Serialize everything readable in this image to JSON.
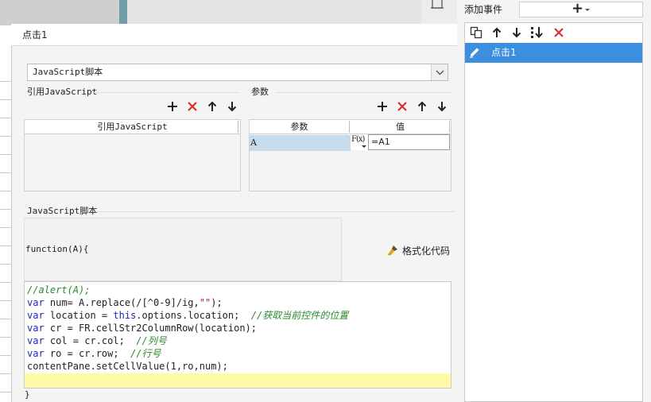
{
  "dialog": {
    "title": "点击1",
    "script_type_selected": "JavaScript脚本",
    "ref_section_label": "引用JavaScript",
    "ref_table_header": "引用JavaScript",
    "param_section_label": "参数",
    "param_table_headers": [
      "参数",
      "值"
    ],
    "param_rows": [
      {
        "name": "A",
        "formula_icon": "F(x)",
        "value": "=A1"
      }
    ],
    "script_section_label": "JavaScript脚本",
    "function_header": "function(A){",
    "format_button_label": "格式化代码",
    "closing_brace": "}"
  },
  "right_panel": {
    "add_event_label": "添加事件",
    "add_button_glyph": "+",
    "events": [
      {
        "label": "点击1"
      }
    ]
  },
  "colors": {
    "accent": "#3c8fdf",
    "delete_red": "#d83030",
    "keyword": "#2020c0",
    "comment": "#2a8a2a",
    "current_line": "#fefaa8"
  }
}
